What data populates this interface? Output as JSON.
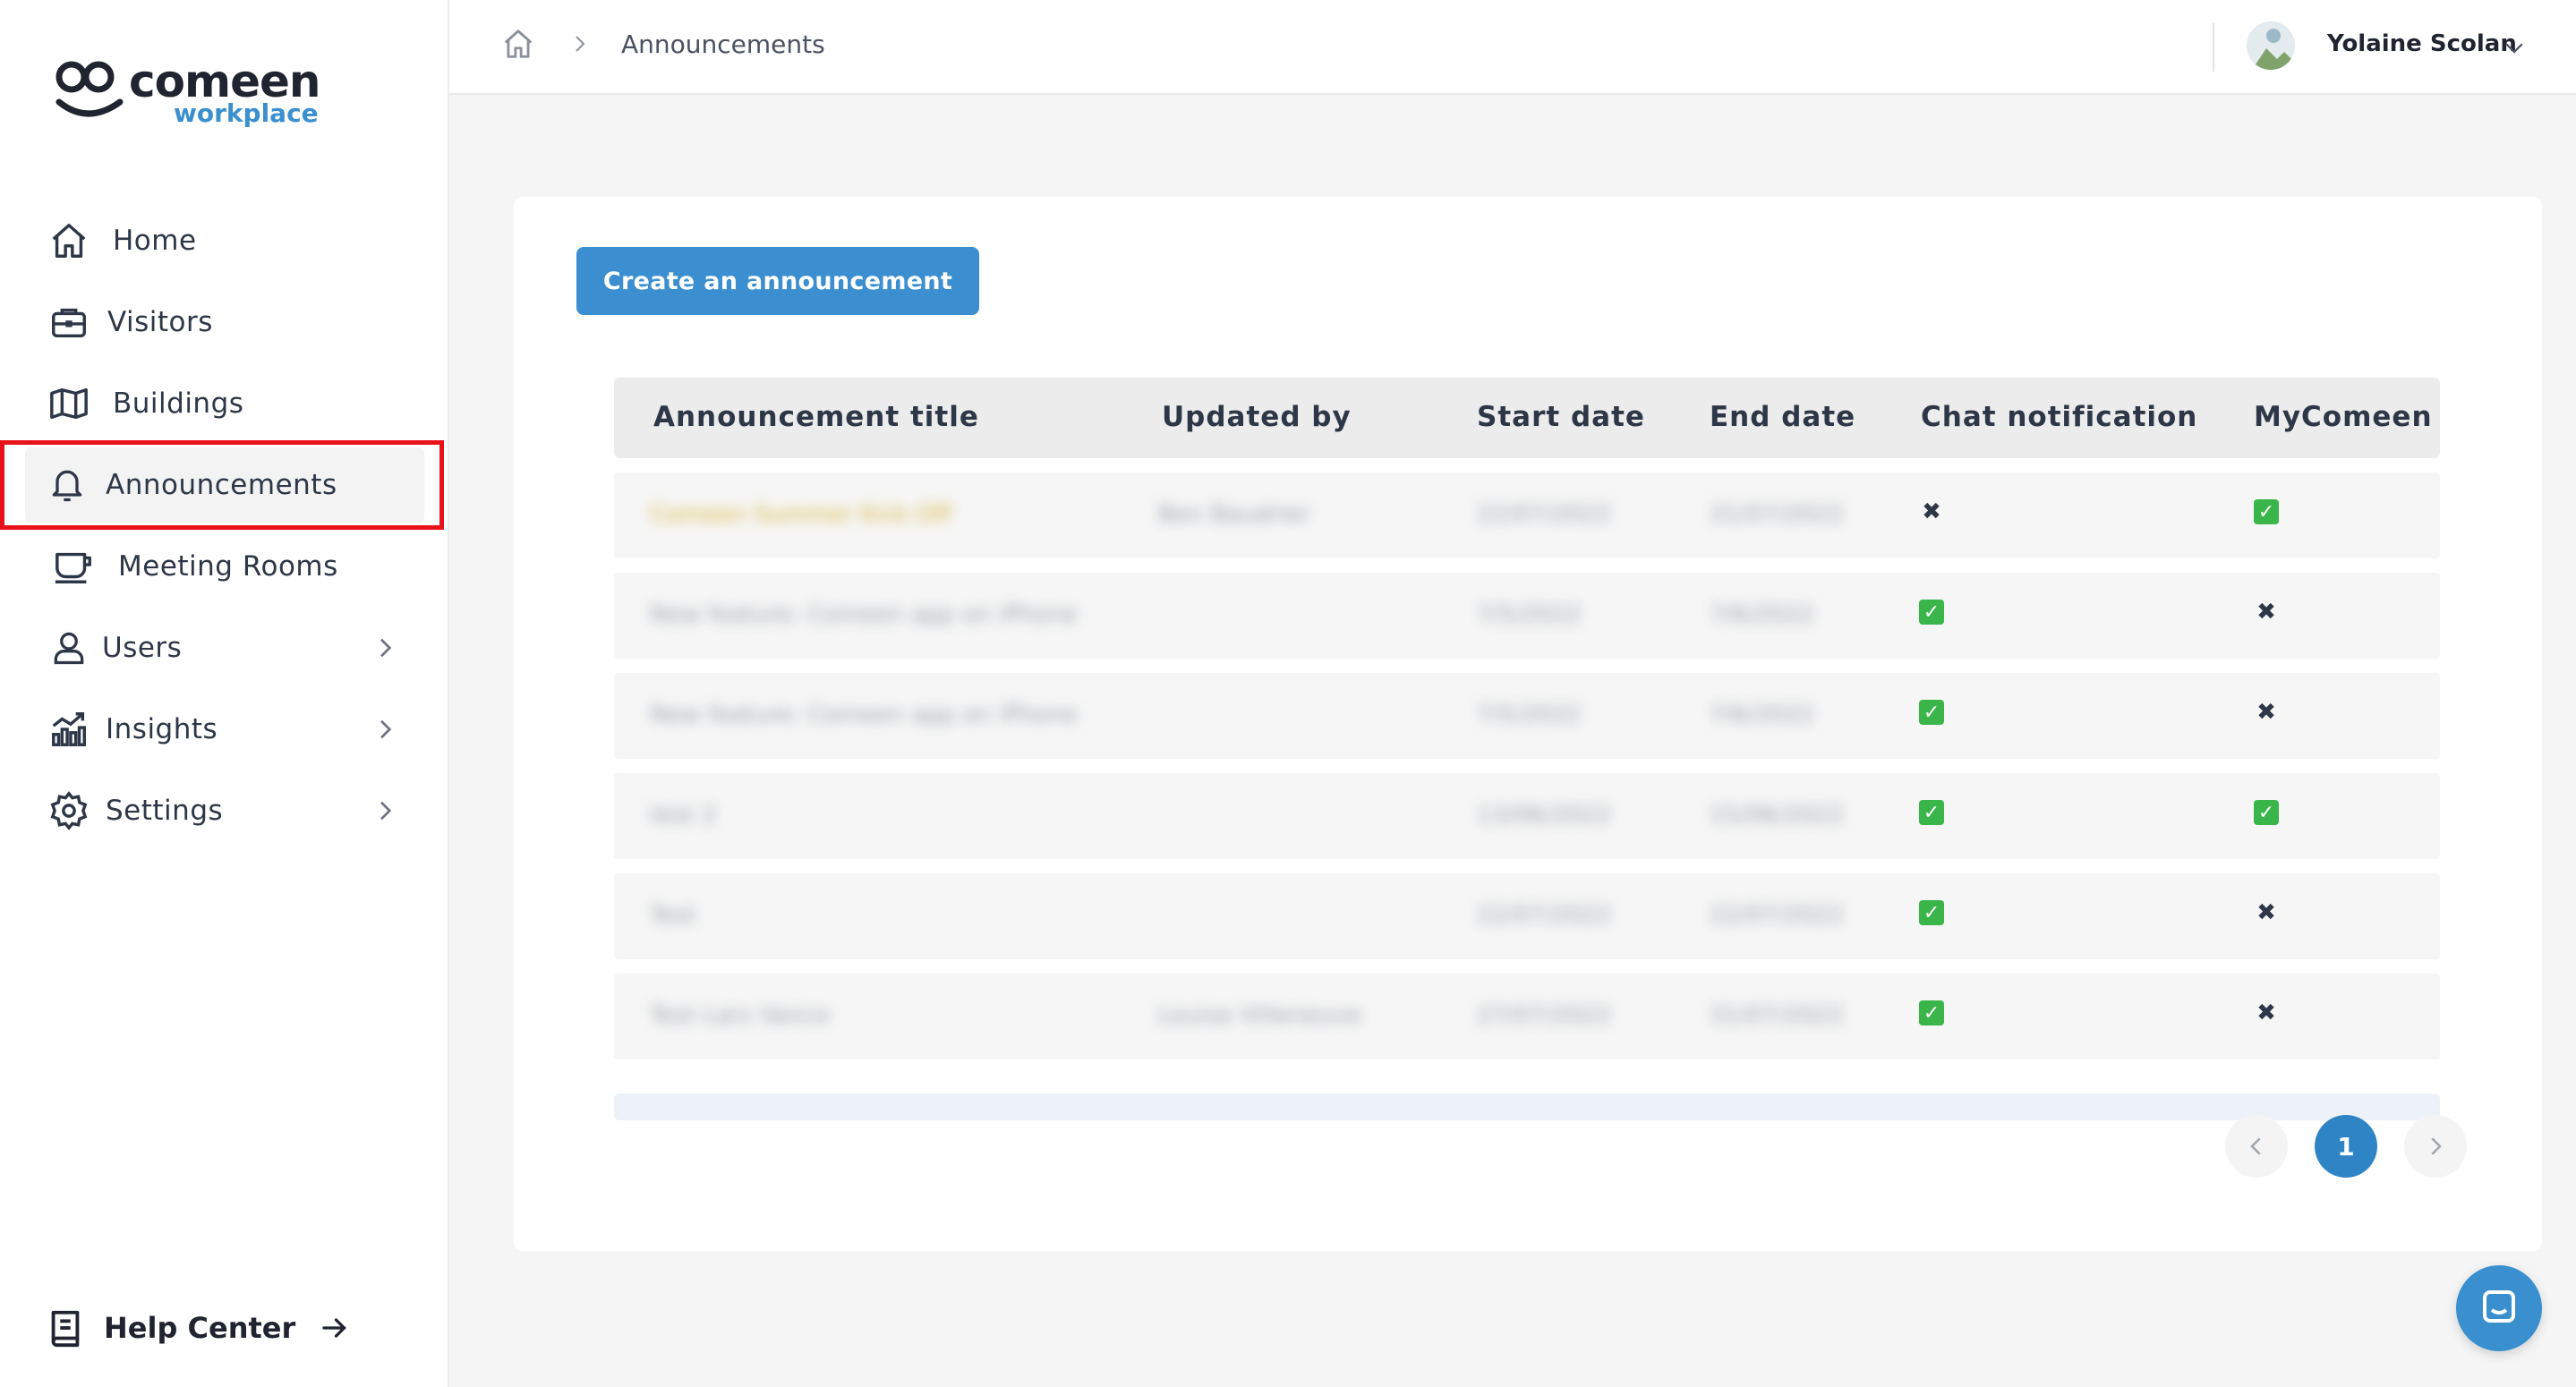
{
  "brand": {
    "name": "comeen",
    "sub": "workplace",
    "accent": "#3a8fcf"
  },
  "sidebar": {
    "items": [
      {
        "label": "Home",
        "icon": "home-icon"
      },
      {
        "label": "Visitors",
        "icon": "briefcase-icon"
      },
      {
        "label": "Buildings",
        "icon": "map-icon"
      },
      {
        "label": "Announcements",
        "icon": "bell-icon",
        "active": true
      },
      {
        "label": "Meeting Rooms",
        "icon": "coffee-cup-icon"
      },
      {
        "label": "Users",
        "icon": "user-icon",
        "expandable": true
      },
      {
        "label": "Insights",
        "icon": "chart-icon",
        "expandable": true
      },
      {
        "label": "Settings",
        "icon": "gear-icon",
        "expandable": true
      }
    ],
    "help_center": "Help Center"
  },
  "header": {
    "breadcrumb_current": "Announcements",
    "user_name": "Yolaine Scolan"
  },
  "main": {
    "create_button": "Create an announcement",
    "table": {
      "columns": [
        "Announcement title",
        "Updated by",
        "Start date",
        "End date",
        "Chat notification",
        "MyComeen b"
      ],
      "rows": [
        {
          "title": "Comeen Summer Kick-Off",
          "updated_by": "Ben Baudrier",
          "start": "22/07/2022",
          "end": "31/07/2022",
          "chat": false,
          "mycomeen": true
        },
        {
          "title": "New feature: Comeen app on iPhone",
          "updated_by": "",
          "start": "7/5/2022",
          "end": "7/6/2022",
          "chat": true,
          "mycomeen": false
        },
        {
          "title": "New feature: Comeen app on iPhone",
          "updated_by": "",
          "start": "7/5/2022",
          "end": "7/6/2022",
          "chat": true,
          "mycomeen": false
        },
        {
          "title": "test 2",
          "updated_by": "",
          "start": "13/06/2022",
          "end": "15/06/2022",
          "chat": true,
          "mycomeen": true
        },
        {
          "title": "Test",
          "updated_by": "",
          "start": "22/07/2022",
          "end": "22/07/2022",
          "chat": true,
          "mycomeen": false
        },
        {
          "title": "Test Lars Vance",
          "updated_by": "Louise Villeneuve",
          "start": "27/07/2022",
          "end": "31/07/2022",
          "chat": true,
          "mycomeen": false
        }
      ]
    },
    "pagination": {
      "current": "1"
    }
  }
}
